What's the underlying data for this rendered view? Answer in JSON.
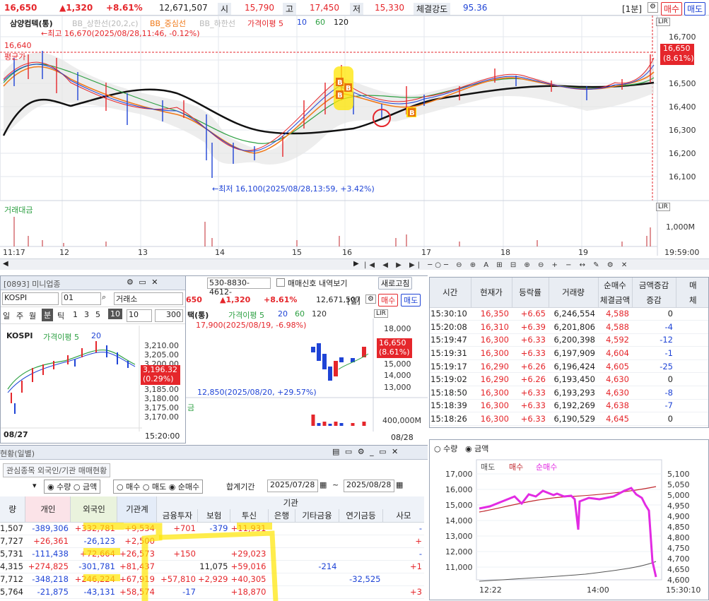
{
  "topbar": {
    "price": "16,650",
    "change": "▲1,320",
    "change_pct": "+8.61%",
    "volume": "12,671,507",
    "open_label": "시",
    "open_value": "15,790",
    "high_label": "고",
    "high_value": "17,450",
    "low_label": "저",
    "low_value": "15,330",
    "strength_label": "체결강도",
    "strength_value": "95.36",
    "interval": "[1분]",
    "buy_btn": "매수",
    "sell_btn": "매도"
  },
  "main_chart": {
    "title": "삼양컴텍(통)",
    "legend": [
      {
        "label": "BB_상한선(20,2,c)",
        "color": "#b9b9b9"
      },
      {
        "label": "BB_중심선",
        "color": "#f07a1a"
      },
      {
        "label": "BB_하한선",
        "color": "#b9b9b9"
      },
      {
        "label": "가격이평 5",
        "color": "#e5262b"
      },
      {
        "label": "10",
        "color": "#1f44d6"
      },
      {
        "label": "60",
        "color": "#2ea043"
      },
      {
        "label": "120",
        "color": "#111111"
      }
    ],
    "high_note": "←최고 16,670(2025/08/28,11:46, -0.12%)",
    "low_note": "←최저 16,100(2025/08/28,13:59, +3.42%)",
    "left_price": "16,640",
    "left_tag": "평균가",
    "price_ticks": [
      "16,700",
      "16,500",
      "16,400",
      "16,300",
      "16,200",
      "16,100"
    ],
    "current_tag_price": "16,650",
    "current_tag_pct": "(8.61%)",
    "volume_title": "거래대금",
    "volume_tick": "1,000M",
    "time_labels": [
      "11:17",
      "12",
      "13",
      "14",
      "15",
      "16",
      "17",
      "18",
      "19",
      "19:59:00"
    ],
    "lir": "LIR"
  },
  "mini_chart": {
    "title": "[0893] 미니업종",
    "index_name": "KOSPI",
    "index_code": "01",
    "market": "거래소",
    "periods": [
      "일",
      "주",
      "월",
      "분",
      "틱"
    ],
    "period_nums": [
      "1",
      "3",
      "5",
      "10"
    ],
    "interval_value": "10",
    "count_value": "300",
    "chart_title": "KOSPI",
    "ma_legend": "가격이평 5",
    "ma_20": "20",
    "y_ticks": [
      "3,210.00",
      "3,205.00",
      "3,200.00",
      "3,185.00",
      "3,180.00",
      "3,175.00",
      "3,170.00"
    ],
    "current_value": "3,196.32",
    "current_pct": "(0.29%)",
    "date_left": "08/27",
    "time_right": "15:20:00"
  },
  "daily_chart": {
    "account": "530-8830-4612-",
    "signal_label": "매매신호 내역보기",
    "refresh": "새로고침",
    "price": "650",
    "change": "▲1,320",
    "change_pct": "+8.61%",
    "volume": "12,671,507",
    "unit": "[일]",
    "buy_btn": "매수",
    "sell_btn": "매도",
    "title": "택(통)",
    "legend_ma": "가격이평 5",
    "legend_20": "20",
    "legend_60": "60",
    "legend_120": "120",
    "high_note": "17,900(2025/08/19, -6.98%)",
    "low_note": "12,850(2025/08/20, +29.57%)",
    "y_ticks": [
      "18,000",
      "15,000",
      "14,000",
      "13,000"
    ],
    "current_price": "16,650",
    "current_pct": "(8.61%)",
    "vol_title": "금",
    "vol_tick": "400,000M",
    "date_right": "08/28"
  },
  "trade_table": {
    "headers": [
      "시간",
      "현재가",
      "등락률",
      "거래량",
      "순매수",
      "금액증감",
      "매"
    ],
    "sub_headers": [
      "체결금액",
      "증감",
      "체"
    ],
    "rows": [
      [
        "15:30:10",
        "16,350",
        "+6.65",
        "6,246,554",
        "4,588",
        "0"
      ],
      [
        "15:20:08",
        "16,310",
        "+6.39",
        "6,201,806",
        "4,588",
        "-4"
      ],
      [
        "15:19:47",
        "16,300",
        "+6.33",
        "6,200,398",
        "4,592",
        "-12"
      ],
      [
        "15:19:31",
        "16,300",
        "+6.33",
        "6,197,909",
        "4,604",
        "-1"
      ],
      [
        "15:19:17",
        "16,290",
        "+6.26",
        "6,196,424",
        "4,605",
        "-25"
      ],
      [
        "15:19:02",
        "16,290",
        "+6.26",
        "6,193,450",
        "4,630",
        "0"
      ],
      [
        "15:18:50",
        "16,300",
        "+6.33",
        "6,193,293",
        "4,630",
        "-8"
      ],
      [
        "15:18:39",
        "16,300",
        "+6.33",
        "6,192,269",
        "4,638",
        "-7"
      ],
      [
        "15:18:26",
        "16,300",
        "+6.33",
        "6,190,529",
        "4,645",
        "0"
      ]
    ]
  },
  "flow_chart": {
    "radio_qty": "수량",
    "radio_amt": "금액",
    "legend": [
      {
        "label": "매도",
        "color": "#555555"
      },
      {
        "label": "매수",
        "color": "#c0272d"
      },
      {
        "label": "순매수",
        "color": "#e22be3"
      }
    ],
    "left_ticks": [
      "17,000",
      "16,000",
      "15,000",
      "14,000",
      "13,000",
      "12,000",
      "11,000"
    ],
    "right_ticks": [
      "5,100",
      "5,050",
      "5,000",
      "4,950",
      "4,900",
      "4,850",
      "4,800",
      "4,750",
      "4,700",
      "4,650",
      "4,600"
    ],
    "time_labels": [
      "12:22",
      "14:00",
      "15:30:10"
    ]
  },
  "investor_panel": {
    "title": "현황(일별)",
    "tab": "관심종목 외국인/기관 매매현황",
    "radios1": [
      "수량",
      "금액"
    ],
    "radios2": [
      "매수",
      "매도",
      "순매수"
    ],
    "period_label": "합계기간",
    "date_from": "2025/07/28",
    "date_to": "2025/08/28",
    "headers": [
      "량",
      "개인",
      "외국인",
      "기관계",
      "금융투자",
      "보험",
      "투신",
      "은행",
      "기타금융",
      "연기금등",
      "사모"
    ],
    "group_header": "기관",
    "rows": [
      [
        "1,507",
        "-389,306",
        "+332,781",
        "+9,534",
        "+701",
        "-379",
        "+11,931",
        "",
        "",
        "",
        "-"
      ],
      [
        "7,727",
        "+26,361",
        "-26,123",
        "+2,500",
        "",
        "",
        "",
        "",
        "",
        "",
        "+"
      ],
      [
        "5,731",
        "-111,438",
        "+72,664",
        "+26,573",
        "+150",
        "",
        "+29,023",
        "",
        "",
        "",
        "-"
      ],
      [
        "4,315",
        "+274,825",
        "-301,781",
        "+81,437",
        "",
        "11,075",
        "+59,016",
        "",
        "-214",
        "",
        "+1"
      ],
      [
        "7,712",
        "-348,218",
        "+246,224",
        "+67,919",
        "+57,810",
        "+2,929",
        "+40,305",
        "",
        "",
        "-32,525",
        ""
      ],
      [
        "5,764",
        "-21,875",
        "-43,131",
        "+58,574",
        "-17",
        "",
        "+18,870",
        "",
        "",
        "",
        "+3"
      ]
    ]
  }
}
